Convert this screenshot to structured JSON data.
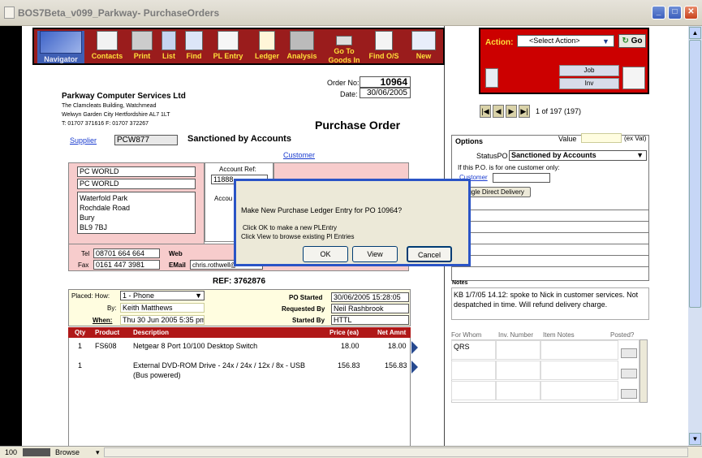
{
  "window": {
    "title": "BOS7Beta_v099_Parkway- PurchaseOrders"
  },
  "toolbar": {
    "buttons": [
      {
        "label": "Navigator",
        "icon": "navigator-icon"
      },
      {
        "label": "Contacts",
        "icon": "contacts-icon"
      },
      {
        "label": "Print",
        "icon": "print-icon"
      },
      {
        "label": "List",
        "icon": "list-icon"
      },
      {
        "label": "Find",
        "icon": "find-icon"
      },
      {
        "label": "PL Entry",
        "icon": "pl-entry-icon"
      },
      {
        "label": "Ledger",
        "icon": "ledger-icon"
      },
      {
        "label": "Analysis",
        "icon": "analysis-icon"
      },
      {
        "label": "Go To",
        "label2": "Goods In",
        "icon": "goods-in-icon"
      },
      {
        "label": "Find O/S",
        "icon": "find-os-icon"
      },
      {
        "label": "New",
        "icon": "new-icon"
      }
    ]
  },
  "action": {
    "label": "Action:",
    "select": "<Select Action>",
    "go": "Go",
    "job": "Job",
    "inv": "Inv"
  },
  "records": {
    "text": "1 of 197 (197)"
  },
  "company": {
    "name": "Parkway Computer Services Ltd",
    "addr1": "The Clamcleats Building, Watchmead",
    "addr2": "Welwyn Garden City   Hertfordshire  AL7 1LT",
    "phone": "T: 01707 371616  F: 01707 372267"
  },
  "order": {
    "no_label": "Order No:",
    "no": "10964",
    "date_label": "Date:",
    "date": "30/06/2005",
    "heading": "Purchase Order",
    "status_heading": "Sanctioned by Accounts",
    "ref": "REF: 3762876"
  },
  "supplier": {
    "link": "Supplier",
    "code": "PCW877",
    "name1": "PC WORLD",
    "name2": "PC WORLD",
    "address": [
      "Waterfold Park",
      "Rochdale Road",
      "Bury",
      "BL9 7BJ"
    ],
    "tel_label": "Tel",
    "tel": "08701 664 664",
    "fax_label": "Fax",
    "fax": "0161 447 3981",
    "web_label": "Web",
    "email_label": "EMail",
    "email": "chris.rothwell@"
  },
  "account": {
    "ref_label": "Account Ref:",
    "ref": "11888",
    "acc_label": "Accou"
  },
  "customer": {
    "link": "Customer"
  },
  "placed": {
    "how_label": "Placed:  How:",
    "how": "1 - Phone",
    "by_label": "By:",
    "by": "Keith Matthews",
    "when_label": "When:",
    "when": "Thu 30 Jun 2005 5:35 pm",
    "started_label": "PO Started",
    "started": "30/06/2005 15:28:05",
    "requested_label": "Requested By",
    "requested": "Neil Rashbrook",
    "startedby_label": "Started By",
    "startedby": "HTTL"
  },
  "items": {
    "headers": [
      "Qty",
      "Product",
      "Description",
      "Price (ea)",
      "Net Amnt"
    ],
    "rows": [
      {
        "qty": "1",
        "product": "FS608",
        "desc": "Netgear 8 Port 10/100 Desktop Switch",
        "desc2": "",
        "price": "18.00",
        "net": "18.00"
      },
      {
        "qty": "1",
        "product": "",
        "desc": "External DVD-ROM Drive - 24x / 24x / 12x / 8x - USB",
        "desc2": "(Bus powered)",
        "price": "156.83",
        "net": "156.83"
      }
    ]
  },
  "options": {
    "title": "Options",
    "value_label": "Value",
    "exvat": "(ex Vat)",
    "statuspo_label": "StatusPO",
    "statuspo": "Sanctioned by Accounts",
    "onecust": "If this P.O. is for one customer only:",
    "customer_link": "Customer",
    "toggle_btn": "Toggle Direct Delivery"
  },
  "notes": {
    "title": "Notes",
    "text": "KB 1/7/05 14.12: spoke to Nick in customer services. Not despatched in time. Will refund delivery charge."
  },
  "ledger": {
    "headers": [
      "For Whom",
      "Inv. Number",
      "Item Notes",
      "Posted?"
    ],
    "rows": [
      {
        "for": "QRS"
      },
      {
        "for": ""
      },
      {
        "for": ""
      }
    ]
  },
  "dialog": {
    "line1": "Make New Purchase Ledger Entry for PO 10964?",
    "line2": "Click OK to make a new PLEntry",
    "line3": "Click View to browse existing Pl Entries",
    "ok": "OK",
    "view": "View",
    "cancel": "Cancel"
  },
  "status": {
    "zoom": "100",
    "mode": "Browse"
  }
}
